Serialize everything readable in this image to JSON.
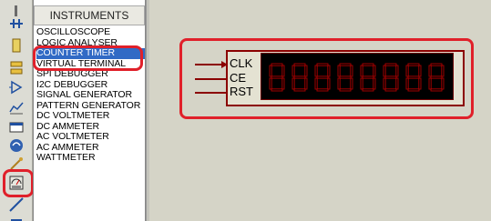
{
  "panel": {
    "title": "INSTRUMENTS",
    "items": [
      "OSCILLOSCOPE",
      "LOGIC ANALYSER",
      "COUNTER TIMER",
      "VIRTUAL TERMINAL",
      "SPI DEBUGGER",
      "I2C DEBUGGER",
      "SIGNAL GENERATOR",
      "PATTERN GENERATOR",
      "DC VOLTMETER",
      "DC AMMETER",
      "AC VOLTMETER",
      "AC AMMETER",
      "WATTMETER"
    ],
    "selected_index": 2
  },
  "component": {
    "pins": [
      "CLK",
      "CE",
      "RST"
    ],
    "digit_count": 8
  },
  "toolbar": {
    "tools": [
      "wire-junction-icon",
      "component-icon",
      "terminal-icon",
      "generator-icon",
      "graph-icon",
      "tape-icon",
      "probe-icon",
      "voltage-probe-icon",
      "virtual-instrument-icon",
      "line-icon",
      "box-icon"
    ]
  },
  "colors": {
    "highlight": "#e0202a",
    "selected_bg": "#316ac5",
    "component_red": "#8b0000",
    "segment_red": "#b00000"
  }
}
